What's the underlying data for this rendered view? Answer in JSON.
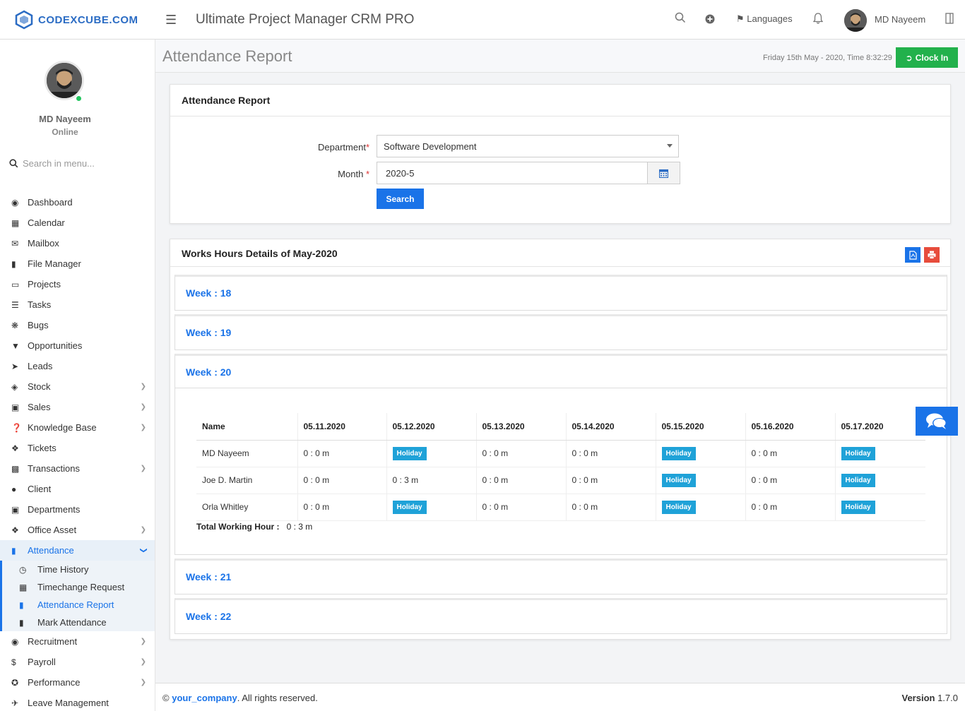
{
  "topbar": {
    "logo_text": "CODEXCUBE.COM",
    "app_title": "Ultimate Project Manager CRM PRO",
    "languages_label": "Languages",
    "user_name": "MD Nayeem"
  },
  "sidebar": {
    "user_name": "MD Nayeem",
    "status": "Online",
    "search_placeholder": "Search in menu...",
    "items": [
      {
        "label": "Dashboard",
        "icon": "dashboard-icon"
      },
      {
        "label": "Calendar",
        "icon": "calendar-icon"
      },
      {
        "label": "Mailbox",
        "icon": "envelope-icon"
      },
      {
        "label": "File Manager",
        "icon": "file-icon"
      },
      {
        "label": "Projects",
        "icon": "folder-icon"
      },
      {
        "label": "Tasks",
        "icon": "tasks-icon"
      },
      {
        "label": "Bugs",
        "icon": "bug-icon"
      },
      {
        "label": "Opportunities",
        "icon": "filter-icon"
      },
      {
        "label": "Leads",
        "icon": "rocket-icon"
      },
      {
        "label": "Stock",
        "icon": "layers-icon"
      },
      {
        "label": "Sales",
        "icon": "cart-icon"
      },
      {
        "label": "Knowledge Base",
        "icon": "question-icon"
      },
      {
        "label": "Tickets",
        "icon": "ticket-icon"
      },
      {
        "label": "Transactions",
        "icon": "building-icon"
      },
      {
        "label": "Client",
        "icon": "users-icon"
      },
      {
        "label": "Departments",
        "icon": "lock-icon"
      },
      {
        "label": "Office Asset",
        "icon": "cube-icon"
      },
      {
        "label": "Attendance",
        "icon": "file-text-icon"
      }
    ],
    "attendance_sub": [
      {
        "label": "Time History",
        "icon": "clock-icon"
      },
      {
        "label": "Timechange Request",
        "icon": "calendar-icon"
      },
      {
        "label": "Attendance Report",
        "icon": "file-text-icon"
      },
      {
        "label": "Mark Attendance",
        "icon": "file-text-icon"
      }
    ],
    "items_after": [
      {
        "label": "Recruitment",
        "icon": "globe-icon"
      },
      {
        "label": "Payroll",
        "icon": "dollar-icon"
      },
      {
        "label": "Performance",
        "icon": "dribbble-icon"
      },
      {
        "label": "Leave Management",
        "icon": "plane-icon"
      }
    ]
  },
  "header": {
    "page_title": "Attendance Report",
    "datetime_text": "Friday 15th May - 2020,  Time   8:32:29",
    "clockin_label": "Clock In"
  },
  "filter": {
    "panel_title": "Attendance Report",
    "department_label": "Department",
    "department_value": "Software Development",
    "month_label": "Month",
    "month_value": "2020-5",
    "search_label": "Search",
    "required_mark": "*"
  },
  "works": {
    "title": "Works Hours Details of May-2020",
    "weeks": [
      "Week : 18",
      "Week : 19",
      "Week : 20",
      "Week : 21",
      "Week : 22"
    ],
    "table": {
      "headers": [
        "Name",
        "05.11.2020",
        "05.12.2020",
        "05.13.2020",
        "05.14.2020",
        "05.15.2020",
        "05.16.2020",
        "05.17.2020"
      ],
      "rows": [
        [
          "MD Nayeem",
          "0 : 0 m",
          "Holiday",
          "0 : 0 m",
          "0 : 0 m",
          "Holiday",
          "0 : 0 m",
          "Holiday"
        ],
        [
          "Joe D. Martin",
          "0 : 0 m",
          "0 : 3 m",
          "0 : 0 m",
          "0 : 0 m",
          "Holiday",
          "0 : 0 m",
          "Holiday"
        ],
        [
          "Orla Whitley",
          "0 : 0 m",
          "Holiday",
          "0 : 0 m",
          "0 : 0 m",
          "Holiday",
          "0 : 0 m",
          "Holiday"
        ]
      ]
    },
    "total_label": "Total Working Hour :",
    "total_value": "0 : 3 m"
  },
  "footer": {
    "copyright_symbol": "©",
    "company": "your_company",
    "rights": ". All rights reserved.",
    "version_label": "Version",
    "version_value": "1.7.0"
  },
  "colors": {
    "primary": "#1a73e8",
    "success": "#22b14c",
    "holiday": "#1fa2d8",
    "danger": "#e74c3c"
  }
}
